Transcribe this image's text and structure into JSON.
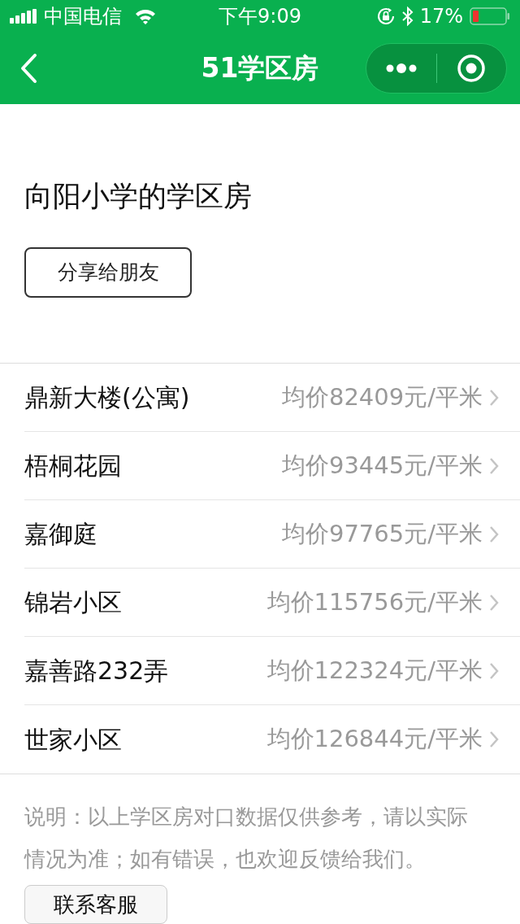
{
  "status_bar": {
    "carrier": "中国电信",
    "time": "下午9:09",
    "battery": "17%"
  },
  "nav_bar": {
    "title": "51学区房"
  },
  "heading": "向阳小学的学区房",
  "share_button": "分享给朋友",
  "listings": [
    {
      "name": "鼎新大楼(公寓)",
      "price": "均价82409元/平米"
    },
    {
      "name": "梧桐花园",
      "price": "均价93445元/平米"
    },
    {
      "name": "嘉御庭",
      "price": "均价97765元/平米"
    },
    {
      "name": "锦岩小区",
      "price": "均价115756元/平米"
    },
    {
      "name": "嘉善路232弄",
      "price": "均价122324元/平米"
    },
    {
      "name": "世家小区",
      "price": "均价126844元/平米"
    }
  ],
  "note": "说明：以上学区房对口数据仅供参考，请以实际情况为准；如有错误，也欢迎反馈给我们。",
  "contact_button": "联系客服"
}
